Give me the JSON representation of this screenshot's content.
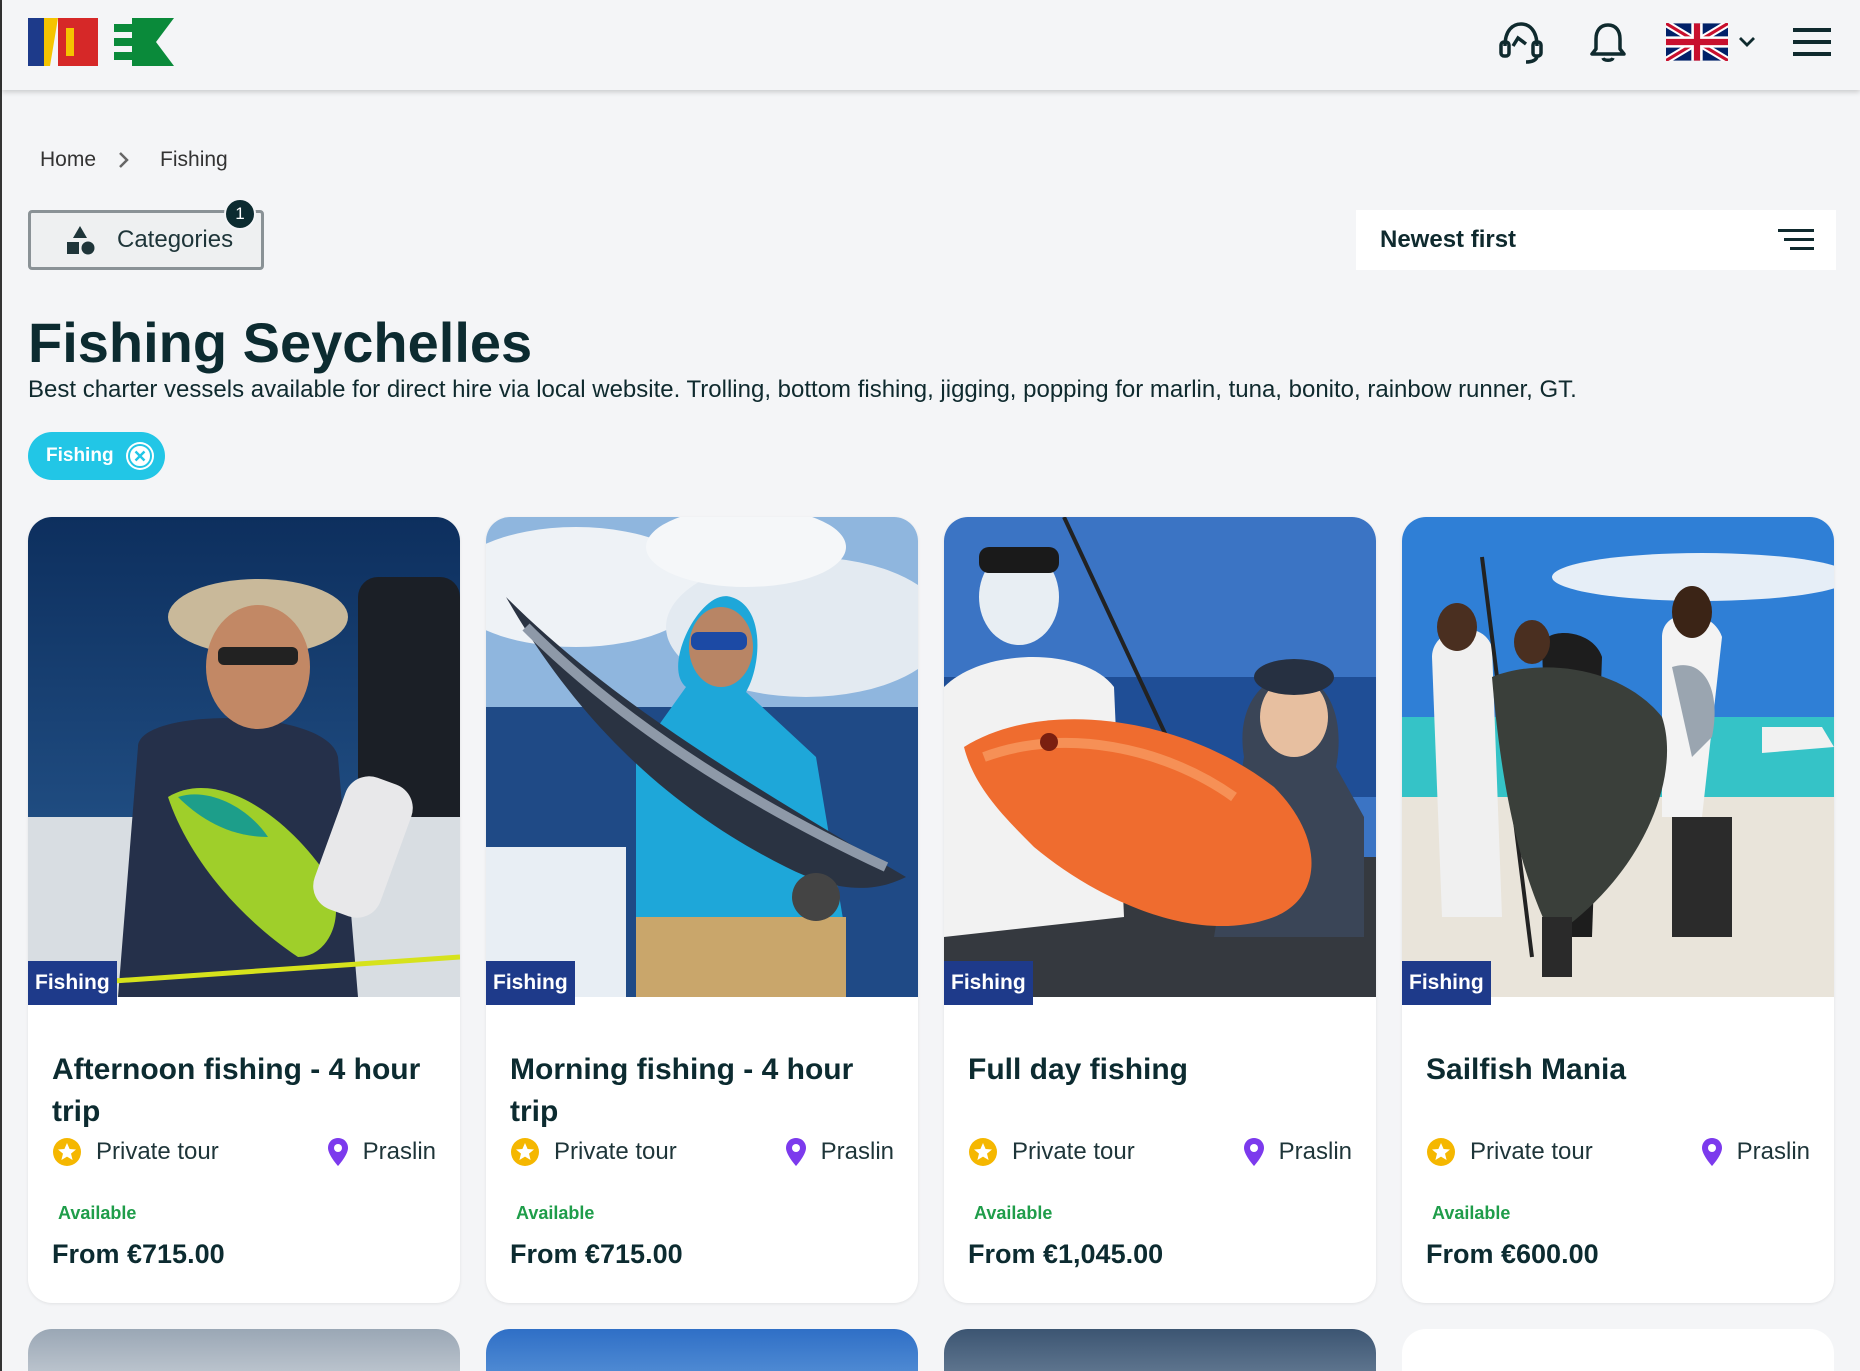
{
  "header": {
    "logo_alt": "logo",
    "icons": [
      "support-agent-icon",
      "bell-icon",
      "uk-flag-icon",
      "chevron-down-icon",
      "hamburger-menu-icon"
    ]
  },
  "breadcrumb": {
    "home": "Home",
    "current": "Fishing"
  },
  "categories": {
    "label": "Categories",
    "count": "1"
  },
  "sort": {
    "label": "Newest first"
  },
  "page": {
    "title": "Fishing Seychelles",
    "description": "Best charter vessels available for direct hire via local website. Trolling, bottom fishing, jigging, popping for marlin, tuna, bonito, rainbow runner, GT."
  },
  "filter_chip": {
    "label": "Fishing"
  },
  "cards": [
    {
      "tag": "Fishing",
      "title": "Afternoon fishing - 4 hour trip",
      "type": "Private tour",
      "location": "Praslin",
      "availability": "Available",
      "price": "From €715.00"
    },
    {
      "tag": "Fishing",
      "title": "Morning fishing - 4 hour trip",
      "type": "Private tour",
      "location": "Praslin",
      "availability": "Available",
      "price": "From €715.00"
    },
    {
      "tag": "Fishing",
      "title": "Full day fishing",
      "type": "Private tour",
      "location": "Praslin",
      "availability": "Available",
      "price": "From €1,045.00"
    },
    {
      "tag": "Fishing",
      "title": "Sailfish Mania",
      "type": "Private tour",
      "location": "Praslin",
      "availability": "Available",
      "price": "From €600.00"
    }
  ],
  "colors": {
    "tag_bg": "#1e3a8a",
    "chip_bg": "#22c6e6",
    "available": "#1f9d4a",
    "pin": "#7c3aed",
    "star": "#f5b700"
  }
}
